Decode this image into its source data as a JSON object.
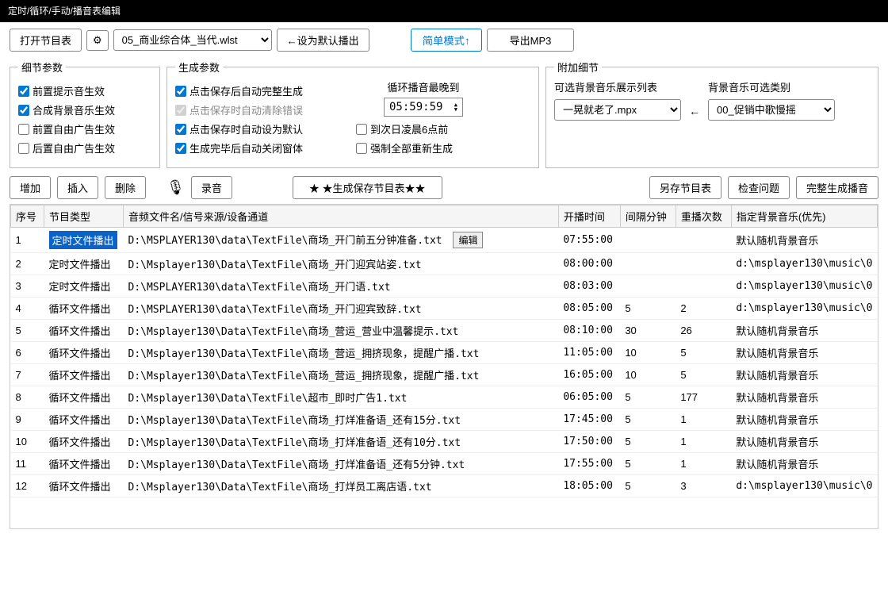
{
  "window": {
    "title": "定时/循环/手动/播音表编辑"
  },
  "toolbar": {
    "open_table": "打开节目表",
    "gear": "⚙",
    "file_select_value": "05_商业综合体_当代.wlst",
    "set_default": "←设为默认播出",
    "simple_mode": "简单模式↑",
    "export_mp3": "导出MP3"
  },
  "detail_params": {
    "legend": "细节参数",
    "c1": "前置提示音生效",
    "c2": "合成背景音乐生效",
    "c3": "前置自由广告生效",
    "c4": "后置自由广告生效"
  },
  "gen_params": {
    "legend": "生成参数",
    "c1": "点击保存后自动完整生成",
    "c2": "点击保存时自动清除错误",
    "c3": "点击保存时自动设为默认",
    "c4": "生成完毕后自动关闭窗体",
    "loop_latest_label": "循环播音最晚到",
    "loop_time": "05:59:59",
    "next_day_6am": "到次日凌晨6点前",
    "force_regen": "强制全部重新生成"
  },
  "extra": {
    "legend": "附加细节",
    "bg_list_label": "可选背景音乐展示列表",
    "bg_list_value": "一晃就老了.mpx",
    "arrow": "←",
    "bg_cat_label": "背景音乐可选类别",
    "bg_cat_value": "00_促销中歌慢摇"
  },
  "actions": {
    "add": "增加",
    "insert": "插入",
    "delete": "删除",
    "record": "录音",
    "generate_save": "★ ★生成保存节目表★★",
    "save_as": "另存节目表",
    "check": "检查问题",
    "full_gen": "完整生成播音"
  },
  "table": {
    "headers": {
      "no": "序号",
      "type": "节目类型",
      "file": "音频文件名/信号来源/设备通道",
      "start": "开播时间",
      "interval": "间隔分钟",
      "repeat": "重播次数",
      "bg": "指定背景音乐(优先)"
    },
    "edit_btn": "编辑",
    "rows": [
      {
        "no": "1",
        "type": "定时文件播出",
        "file": "D:\\MSPLAYER130\\data\\TextFile\\商场_开门前五分钟准备.txt",
        "start": "07:55:00",
        "interval": "",
        "repeat": "",
        "bg": "默认随机背景音乐",
        "sel": true,
        "edit": true
      },
      {
        "no": "2",
        "type": "定时文件播出",
        "file": "D:\\Msplayer130\\Data\\TextFile\\商场_开门迎宾站姿.txt",
        "start": "08:00:00",
        "interval": "",
        "repeat": "",
        "bg": "d:\\msplayer130\\music\\0"
      },
      {
        "no": "3",
        "type": "定时文件播出",
        "file": "D:\\MSPLAYER130\\data\\TextFile\\商场_开门语.txt",
        "start": "08:03:00",
        "interval": "",
        "repeat": "",
        "bg": "d:\\msplayer130\\music\\0"
      },
      {
        "no": "4",
        "type": "循环文件播出",
        "file": "D:\\MSPLAYER130\\data\\TextFile\\商场_开门迎宾致辞.txt",
        "start": "08:05:00",
        "interval": "5",
        "repeat": "2",
        "bg": "d:\\msplayer130\\music\\0"
      },
      {
        "no": "5",
        "type": "循环文件播出",
        "file": "D:\\Msplayer130\\Data\\TextFile\\商场_营运_营业中温馨提示.txt",
        "start": "08:10:00",
        "interval": "30",
        "repeat": "26",
        "bg": "默认随机背景音乐"
      },
      {
        "no": "6",
        "type": "循环文件播出",
        "file": "D:\\Msplayer130\\Data\\TextFile\\商场_营运_拥挤现象，提醒广播.txt",
        "start": "11:05:00",
        "interval": "10",
        "repeat": "5",
        "bg": "默认随机背景音乐"
      },
      {
        "no": "7",
        "type": "循环文件播出",
        "file": "D:\\Msplayer130\\Data\\TextFile\\商场_营运_拥挤现象，提醒广播.txt",
        "start": "16:05:00",
        "interval": "10",
        "repeat": "5",
        "bg": "默认随机背景音乐"
      },
      {
        "no": "8",
        "type": "循环文件播出",
        "file": "D:\\Msplayer130\\Data\\TextFile\\超市_即时广告1.txt",
        "start": "06:05:00",
        "interval": "5",
        "repeat": "177",
        "bg": "默认随机背景音乐"
      },
      {
        "no": "9",
        "type": "循环文件播出",
        "file": "D:\\Msplayer130\\Data\\TextFile\\商场_打烊准备语_还有15分.txt",
        "start": "17:45:00",
        "interval": "5",
        "repeat": "1",
        "bg": "默认随机背景音乐"
      },
      {
        "no": "10",
        "type": "循环文件播出",
        "file": "D:\\Msplayer130\\Data\\TextFile\\商场_打烊准备语_还有10分.txt",
        "start": "17:50:00",
        "interval": "5",
        "repeat": "1",
        "bg": "默认随机背景音乐"
      },
      {
        "no": "11",
        "type": "循环文件播出",
        "file": "D:\\Msplayer130\\Data\\TextFile\\商场_打烊准备语_还有5分钟.txt",
        "start": "17:55:00",
        "interval": "5",
        "repeat": "1",
        "bg": "默认随机背景音乐"
      },
      {
        "no": "12",
        "type": "循环文件播出",
        "file": "D:\\Msplayer130\\Data\\TextFile\\商场_打烊员工离店语.txt",
        "start": "18:05:00",
        "interval": "5",
        "repeat": "3",
        "bg": "d:\\msplayer130\\music\\0"
      }
    ]
  }
}
